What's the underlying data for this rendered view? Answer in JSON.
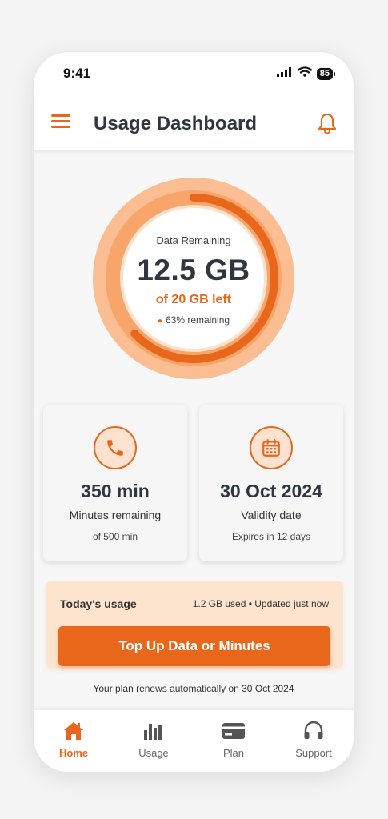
{
  "status_bar": {
    "time": "9:41",
    "battery": "85"
  },
  "header": {
    "title": "Usage Dashboard",
    "menu_icon": "hamburger-menu-icon",
    "bell_icon": "bell-icon"
  },
  "data_ring": {
    "label": "Data Remaining",
    "value": "12.5 GB",
    "sub": "of 20 GB left",
    "percent_text": "63% remaining",
    "fraction_remaining": 0.63
  },
  "cards": {
    "minutes": {
      "icon": "phone-icon",
      "value": "350 min",
      "label": "Minutes remaining",
      "note": "of 500 min"
    },
    "validity": {
      "icon": "calendar-icon",
      "value": "30 Oct 2024",
      "label": "Validity date",
      "note": "Expires in 12 days"
    }
  },
  "today": {
    "title": "Today's usage",
    "info": "1.2 GB used • Updated just now",
    "button": "Top Up Data or Minutes"
  },
  "renew_note": "Your plan renews automatically on 30 Oct 2024",
  "nav": {
    "items": [
      {
        "label": "Home",
        "icon": "home-icon",
        "active": true
      },
      {
        "label": "Usage",
        "icon": "bar-chart-icon",
        "active": false
      },
      {
        "label": "Plan",
        "icon": "card-icon",
        "active": false
      },
      {
        "label": "Support",
        "icon": "headset-icon",
        "active": false
      }
    ]
  },
  "colors": {
    "accent": "#e8671a",
    "accent_light": "#fde4cf",
    "ring_light": "#fbbe92",
    "text_dark": "#2f3640"
  }
}
